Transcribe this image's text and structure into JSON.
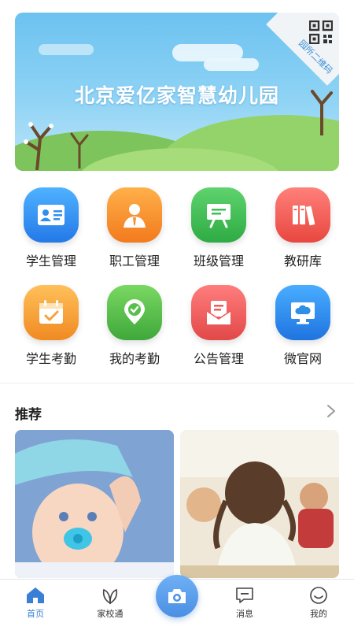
{
  "banner": {
    "title": "北京爱亿家智慧幼儿园",
    "corner_label": "园所二维码"
  },
  "features": [
    {
      "label": "学生管理",
      "icon": "student-card-icon",
      "color": "#2f8ff0"
    },
    {
      "label": "职工管理",
      "icon": "staff-person-icon",
      "color": "#f5922d"
    },
    {
      "label": "班级管理",
      "icon": "class-board-icon",
      "color": "#3cbf55"
    },
    {
      "label": "教研库",
      "icon": "books-icon",
      "color": "#f2615b"
    },
    {
      "label": "学生考勤",
      "icon": "calendar-check-icon",
      "color": "#f5a43a"
    },
    {
      "label": "我的考勤",
      "icon": "location-check-icon",
      "color": "#55c04a"
    },
    {
      "label": "公告管理",
      "icon": "notice-envelope-icon",
      "color": "#f05a5a"
    },
    {
      "label": "微官网",
      "icon": "monitor-cloud-icon",
      "color": "#2d8fe6"
    }
  ],
  "recommend": {
    "title": "推荐"
  },
  "tabbar": {
    "home": "首页",
    "school": "家校通",
    "messages": "消息",
    "mine": "我的"
  },
  "colors": {
    "accent": "#3a7fd6"
  }
}
